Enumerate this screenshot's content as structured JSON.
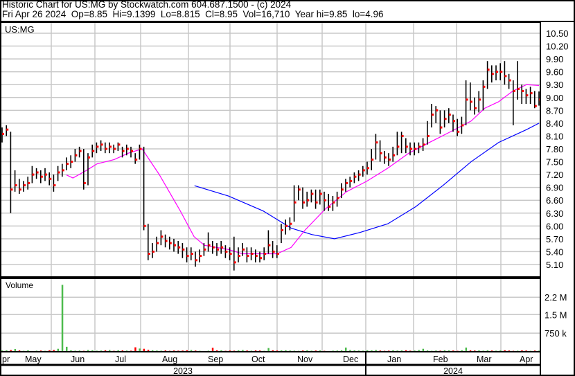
{
  "header": {
    "title": "Historic Chart for US:MG by Stockwatch.com 604.687.1500 - (c) 2024",
    "quote": "Fri Apr 26 2024  Op=8.85  Hi=9.1399  Lo=8.815  Cl=8.95  Vol=16,710  Year hi=9.85  lo=4.96"
  },
  "colors": {
    "bar": "#000000",
    "close_tick": "#ff0000",
    "ma_short": "#ff00ff",
    "ma_long": "#0000ff",
    "vol_up": "#4cbb4c",
    "vol_down": "#ff0000",
    "grid": "#c8c8c8"
  },
  "chart_data": {
    "type": "line",
    "title": "US:MG",
    "price_axis": {
      "ticks": [
        "10.50",
        "10.20",
        "9.90",
        "9.60",
        "9.30",
        "9.00",
        "8.70",
        "8.40",
        "8.10",
        "7.80",
        "7.50",
        "7.20",
        "6.90",
        "6.60",
        "6.30",
        "6.00",
        "5.70",
        "5.40",
        "5.10"
      ],
      "ylim": [
        4.92,
        10.75
      ]
    },
    "volume_axis": {
      "label": "Volume",
      "ticks": [
        {
          "label": "2.2 M",
          "value": 2200
        },
        {
          "label": "1.5 M",
          "value": 1500
        },
        {
          "label": "750 k",
          "value": 750
        }
      ],
      "unit": "thousands",
      "ylim": [
        0,
        2900
      ]
    },
    "months": [
      "pr",
      "May",
      "Jun",
      "Jul",
      "Aug",
      "Sep",
      "Oct",
      "Nov",
      "Dec",
      "Jan",
      "Feb",
      "Mar",
      "Apr"
    ],
    "years": [
      "2023",
      "2024"
    ],
    "close": [
      8.15,
      8.25,
      6.85,
      6.95,
      6.85,
      6.95,
      7.0,
      7.2,
      7.25,
      7.15,
      7.2,
      7.1,
      6.95,
      7.25,
      7.3,
      7.45,
      7.5,
      7.65,
      7.75,
      7.0,
      7.6,
      7.75,
      7.85,
      7.9,
      7.8,
      7.85,
      7.8,
      7.9,
      7.75,
      7.8,
      7.75,
      7.55,
      7.8,
      6.0,
      5.35,
      5.4,
      5.6,
      5.75,
      5.65,
      5.6,
      5.55,
      5.5,
      5.45,
      5.3,
      5.35,
      5.2,
      5.3,
      5.45,
      5.55,
      5.5,
      5.45,
      5.5,
      5.4,
      5.35,
      5.15,
      5.3,
      5.45,
      5.3,
      5.35,
      5.3,
      5.25,
      5.35,
      5.55,
      5.4,
      5.35,
      5.9,
      6.0,
      6.05,
      6.55,
      6.85,
      6.55,
      6.6,
      6.75,
      6.55,
      6.75,
      6.6,
      6.45,
      6.55,
      6.65,
      6.85,
      7.0,
      7.05,
      7.15,
      7.2,
      7.3,
      7.35,
      7.55,
      7.95,
      7.7,
      7.6,
      7.55,
      7.65,
      7.85,
      8.1,
      7.85,
      7.8,
      7.8,
      7.85,
      7.9,
      8.1,
      8.6,
      8.7,
      8.3,
      8.5,
      8.6,
      8.45,
      8.2,
      8.35,
      8.95,
      8.9,
      8.75,
      8.95,
      9.25,
      9.65,
      9.55,
      9.6,
      9.6,
      9.5,
      9.4,
      9.15,
      9.2,
      9.15,
      9.05,
      9.1,
      8.8,
      8.95
    ],
    "high": [
      8.3,
      8.35,
      8.2,
      7.3,
      7.1,
      7.05,
      7.15,
      7.4,
      7.35,
      7.3,
      7.35,
      7.25,
      7.2,
      7.4,
      7.45,
      7.6,
      7.65,
      7.8,
      7.85,
      7.8,
      7.7,
      7.9,
      7.95,
      8.0,
      7.95,
      7.95,
      7.9,
      7.95,
      7.85,
      7.9,
      7.85,
      7.7,
      7.9,
      7.85,
      6.05,
      5.6,
      5.75,
      5.9,
      5.8,
      5.75,
      5.7,
      5.65,
      5.6,
      5.5,
      5.5,
      5.4,
      5.45,
      5.6,
      5.85,
      5.65,
      5.6,
      5.65,
      5.55,
      5.5,
      5.75,
      5.5,
      5.6,
      5.5,
      5.5,
      5.45,
      5.4,
      5.5,
      5.9,
      5.65,
      5.55,
      6.05,
      6.15,
      6.2,
      6.95,
      6.95,
      6.9,
      6.8,
      6.85,
      6.85,
      6.85,
      6.8,
      6.75,
      6.7,
      6.8,
      7.0,
      7.1,
      7.15,
      7.25,
      7.3,
      7.4,
      7.5,
      7.8,
      8.15,
      8.0,
      7.75,
      7.7,
      7.85,
      8.2,
      8.2,
      8.05,
      7.95,
      7.95,
      7.95,
      8.05,
      8.45,
      8.85,
      8.8,
      8.7,
      8.7,
      8.75,
      8.6,
      8.5,
      8.55,
      9.4,
      9.35,
      9.0,
      9.15,
      9.4,
      9.85,
      9.75,
      9.75,
      9.8,
      9.85,
      9.55,
      9.4,
      9.85,
      9.3,
      9.2,
      9.25,
      9.15,
      9.14
    ],
    "low": [
      7.95,
      8.1,
      6.3,
      6.8,
      6.75,
      6.8,
      6.85,
      7.0,
      7.1,
      7.0,
      7.05,
      6.95,
      6.8,
      7.05,
      7.15,
      7.3,
      7.35,
      7.5,
      7.6,
      6.85,
      6.95,
      7.6,
      7.7,
      7.75,
      7.7,
      7.7,
      7.7,
      7.75,
      7.6,
      7.65,
      7.6,
      7.45,
      7.55,
      5.9,
      5.2,
      5.25,
      5.4,
      5.55,
      5.5,
      5.45,
      5.4,
      5.35,
      5.25,
      5.15,
      5.2,
      5.05,
      5.15,
      5.3,
      5.4,
      5.35,
      5.3,
      5.35,
      5.25,
      5.2,
      4.96,
      5.15,
      5.3,
      5.15,
      5.2,
      5.15,
      5.15,
      5.2,
      5.35,
      5.25,
      5.25,
      5.6,
      5.8,
      5.9,
      6.1,
      6.6,
      6.4,
      6.45,
      6.55,
      6.4,
      6.5,
      6.35,
      6.35,
      6.35,
      6.45,
      6.65,
      6.8,
      6.9,
      7.0,
      7.05,
      7.15,
      7.2,
      7.3,
      7.55,
      7.5,
      7.45,
      7.4,
      7.5,
      7.65,
      7.7,
      7.7,
      7.65,
      7.65,
      7.7,
      7.75,
      7.9,
      8.3,
      8.4,
      8.15,
      8.3,
      8.4,
      8.2,
      8.1,
      8.15,
      8.35,
      8.7,
      8.6,
      8.65,
      8.7,
      9.2,
      9.35,
      9.4,
      9.4,
      9.3,
      9.2,
      8.35,
      8.95,
      8.85,
      8.85,
      8.85,
      8.75,
      8.81
    ],
    "volume_k": [
      50,
      60,
      70,
      110,
      55,
      40,
      60,
      30,
      45,
      50,
      40,
      60,
      70,
      120,
      2700,
      200,
      60,
      45,
      50,
      40,
      70,
      60,
      45,
      50,
      60,
      70,
      40,
      60,
      55,
      50,
      45,
      180,
      130,
      120,
      80,
      60,
      50,
      45,
      55,
      40,
      50,
      45,
      50,
      60,
      70,
      50,
      40,
      30,
      45,
      160,
      55,
      60,
      40,
      50,
      45,
      60,
      70,
      50,
      45,
      55,
      50,
      40,
      150,
      60,
      50,
      55,
      60,
      50,
      45,
      40,
      50,
      60,
      45,
      50,
      55,
      40,
      30,
      45,
      50,
      60,
      170,
      70,
      55,
      50,
      45,
      60,
      55,
      70,
      50,
      40,
      45,
      60,
      50,
      55,
      60,
      45,
      50,
      70,
      120,
      55,
      40,
      50,
      45,
      60,
      55,
      50,
      40,
      60,
      170,
      60,
      50,
      55,
      45,
      60,
      50,
      45,
      55,
      60,
      50,
      40,
      45,
      55,
      50,
      40,
      50,
      45
    ],
    "ma_short": [
      [
        15,
        7.19
      ],
      [
        16.5,
        7.12
      ],
      [
        19.7,
        7.3
      ],
      [
        22.1,
        7.45
      ],
      [
        26.1,
        7.55
      ],
      [
        29.4,
        7.7
      ],
      [
        32.6,
        7.8
      ],
      [
        36.6,
        7.2
      ],
      [
        41.5,
        6.35
      ],
      [
        44.7,
        5.75
      ],
      [
        47.1,
        5.55
      ],
      [
        52.7,
        5.45
      ],
      [
        56,
        5.35
      ],
      [
        64,
        5.35
      ],
      [
        67.3,
        5.5
      ],
      [
        70.5,
        5.9
      ],
      [
        75.3,
        6.4
      ],
      [
        80.2,
        6.8
      ],
      [
        85,
        7.05
      ],
      [
        89.8,
        7.35
      ],
      [
        94.7,
        7.7
      ],
      [
        99.5,
        7.95
      ],
      [
        104.4,
        8.2
      ],
      [
        109.2,
        8.45
      ],
      [
        112.4,
        8.75
      ],
      [
        115.6,
        8.9
      ],
      [
        118.9,
        9.15
      ],
      [
        122.1,
        9.3
      ],
      [
        125,
        9.28
      ]
    ],
    "ma_long": [
      [
        44.8,
        6.94
      ],
      [
        52.7,
        6.7
      ],
      [
        60.8,
        6.35
      ],
      [
        67.3,
        5.95
      ],
      [
        72.1,
        5.8
      ],
      [
        77.4,
        5.7
      ],
      [
        83.4,
        5.85
      ],
      [
        89.8,
        6.05
      ],
      [
        96.3,
        6.45
      ],
      [
        102.7,
        6.95
      ],
      [
        109.2,
        7.5
      ],
      [
        115.6,
        7.95
      ],
      [
        122.1,
        8.25
      ],
      [
        125,
        8.4
      ]
    ]
  }
}
